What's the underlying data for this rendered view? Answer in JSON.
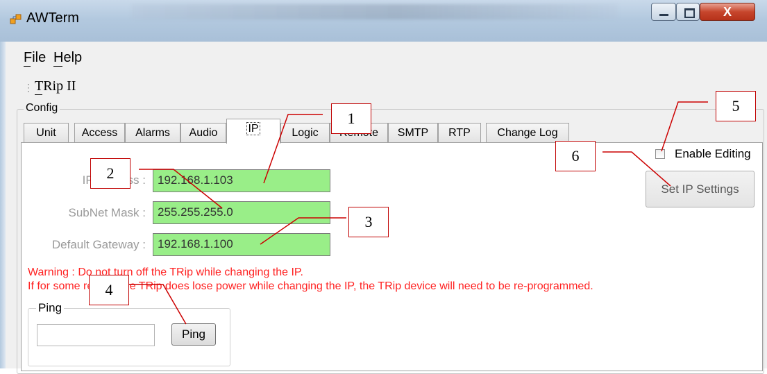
{
  "window": {
    "title": "AWTerm"
  },
  "menu": {
    "file": "File",
    "help": "Help"
  },
  "toolbar": {
    "device": "TRip II"
  },
  "config": {
    "label": "Config"
  },
  "tabs": [
    {
      "label": "Unit"
    },
    {
      "label": "Access"
    },
    {
      "label": "Alarms"
    },
    {
      "label": "Audio"
    },
    {
      "label": "IP",
      "active": true
    },
    {
      "label": "Logic"
    },
    {
      "label": "Remote"
    },
    {
      "label": "SMTP"
    },
    {
      "label": "RTP"
    },
    {
      "label": "Change Log"
    }
  ],
  "ip": {
    "address_label": "IP Address :",
    "address_value": "192.168.1.103",
    "subnet_label": "SubNet Mask :",
    "subnet_value": "255.255.255.0",
    "gateway_label": "Default Gateway :",
    "gateway_value": "192.168.1.100"
  },
  "editing": {
    "enable_label": "Enable Editing",
    "checked": false,
    "set_button": "Set IP Settings"
  },
  "warning": {
    "line1": "Warning : Do not turn off the TRip while changing the IP.",
    "line2": "If for some reason the TRip does lose power while changing the IP, the TRip device will need to be re-programmed.",
    "color": "#ff2222"
  },
  "ping": {
    "group_label": "Ping",
    "input_value": "",
    "button": "Ping"
  },
  "callouts": [
    "1",
    "2",
    "3",
    "4",
    "5",
    "6"
  ],
  "colors": {
    "field_bg": "#99ee88",
    "callout_border": "#c00000",
    "close_button": "#c7462d"
  }
}
